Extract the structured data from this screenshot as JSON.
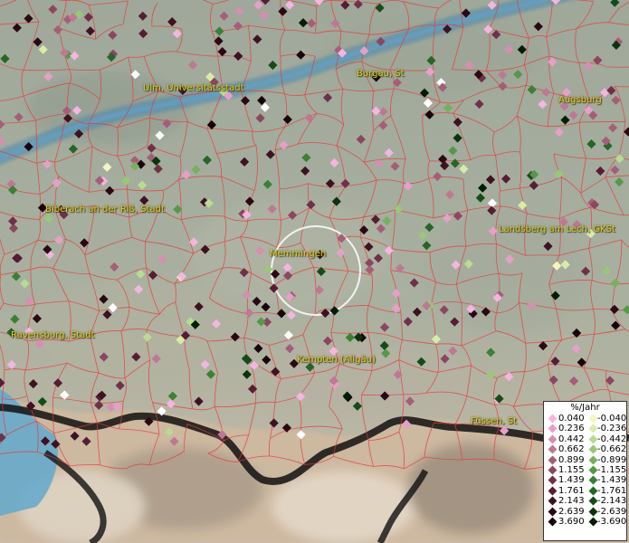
{
  "map": {
    "cities": [
      {
        "name": "Ulm, Universitätsstadt"
      },
      {
        "name": "Burgau, St"
      },
      {
        "name": "Augsburg"
      },
      {
        "name": "Biberach an der Riß, Stadt"
      },
      {
        "name": "Landsberg am Lech, GKSt"
      },
      {
        "name": "Memmingen"
      },
      {
        "name": "Ravensburg, Stadt"
      },
      {
        "name": "Kempten (Allgäu)"
      },
      {
        "name": "Füssen, St"
      }
    ],
    "legend": {
      "title": "%/Jahr",
      "positive": [
        {
          "label": "0.040",
          "color": "#f2b6e0"
        },
        {
          "label": "0.236",
          "color": "#e6a0c8"
        },
        {
          "label": "0.442",
          "color": "#d58fb0"
        },
        {
          "label": "0.662",
          "color": "#bf7894"
        },
        {
          "label": "0.899",
          "color": "#a65e78"
        },
        {
          "label": "1.155",
          "color": "#8c4660"
        },
        {
          "label": "1.439",
          "color": "#70304a"
        },
        {
          "label": "1.761",
          "color": "#561e34"
        },
        {
          "label": "2.143",
          "color": "#3e1222"
        },
        {
          "label": "2.639",
          "color": "#2a0814"
        },
        {
          "label": "3.690",
          "color": "#180208"
        }
      ],
      "negative": [
        {
          "label": "-0.040",
          "color": "#f2f6c0"
        },
        {
          "label": "-0.236",
          "color": "#d8eca8"
        },
        {
          "label": "-0.442",
          "color": "#b8dc90"
        },
        {
          "label": "-0.662",
          "color": "#98c878"
        },
        {
          "label": "-0.899",
          "color": "#76b060"
        },
        {
          "label": "-1.155",
          "color": "#56984a"
        },
        {
          "label": "-1.439",
          "color": "#3c8036"
        },
        {
          "label": "-1.761",
          "color": "#266626"
        },
        {
          "label": "-2.143",
          "color": "#144c18"
        },
        {
          "label": "-2.639",
          "color": "#0a340c"
        },
        {
          "label": "-3.690",
          "color": "#041c04"
        }
      ]
    }
  }
}
